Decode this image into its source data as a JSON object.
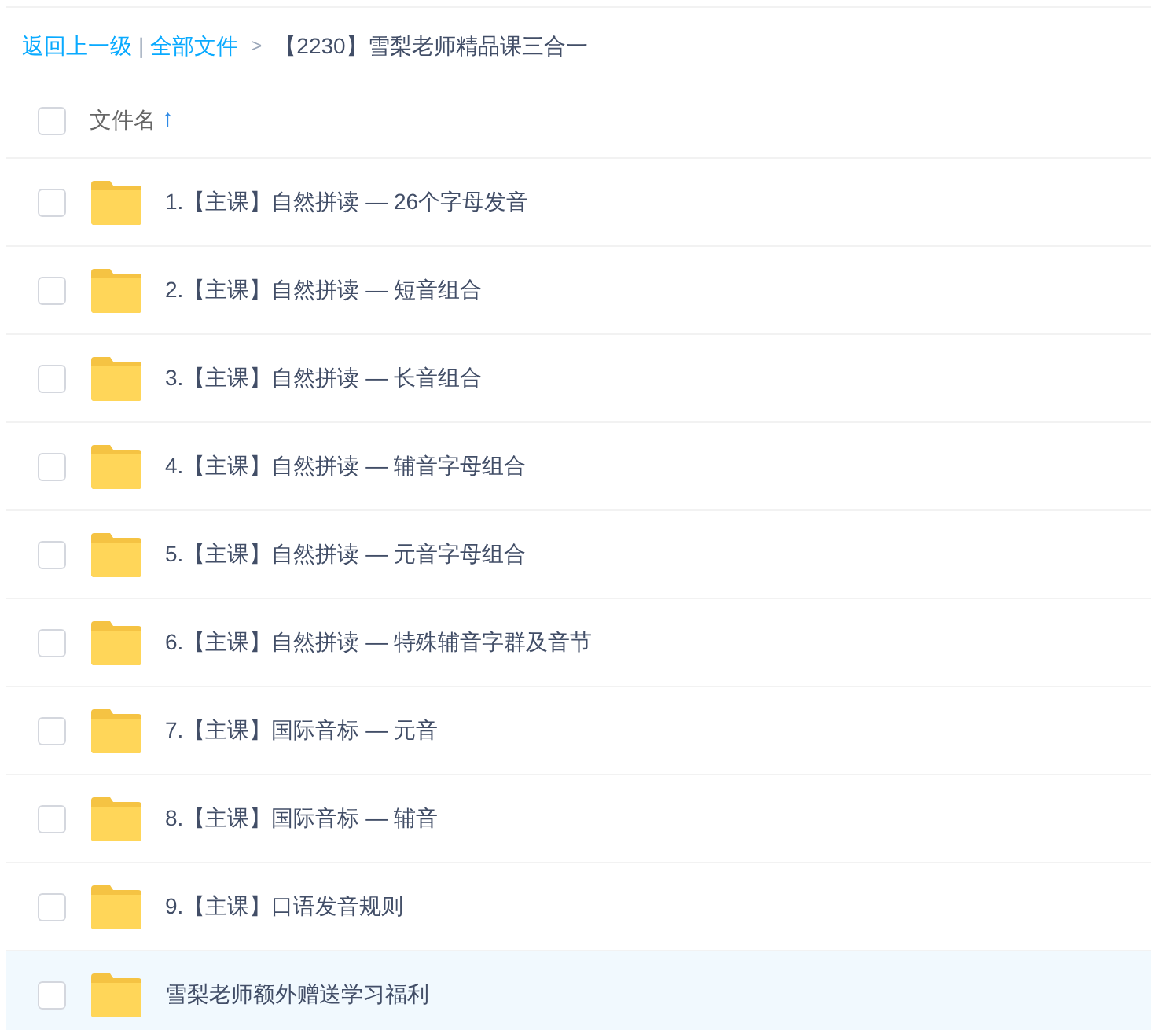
{
  "breadcrumb": {
    "back": "返回上一级",
    "separator": "|",
    "root": "全部文件",
    "arrow": ">",
    "current": "【2230】雪梨老师精品课三合一"
  },
  "header": {
    "checked": false,
    "column": "文件名",
    "sort": "↑"
  },
  "files": [
    {
      "name": "1.【主课】自然拼读 — 26个字母发音",
      "checked": false,
      "highlighted": false
    },
    {
      "name": "2.【主课】自然拼读 — 短音组合",
      "checked": false,
      "highlighted": false
    },
    {
      "name": "3.【主课】自然拼读 — 长音组合",
      "checked": false,
      "highlighted": false
    },
    {
      "name": "4.【主课】自然拼读 — 辅音字母组合",
      "checked": false,
      "highlighted": false
    },
    {
      "name": "5.【主课】自然拼读 — 元音字母组合",
      "checked": false,
      "highlighted": false
    },
    {
      "name": "6.【主课】自然拼读 — 特殊辅音字群及音节",
      "checked": false,
      "highlighted": false
    },
    {
      "name": "7.【主课】国际音标 — 元音",
      "checked": false,
      "highlighted": false
    },
    {
      "name": "8.【主课】国际音标 — 辅音",
      "checked": false,
      "highlighted": false
    },
    {
      "name": "9.【主课】口语发音规则",
      "checked": false,
      "highlighted": false
    },
    {
      "name": "雪梨老师额外赠送学习福利",
      "checked": false,
      "highlighted": true
    }
  ]
}
